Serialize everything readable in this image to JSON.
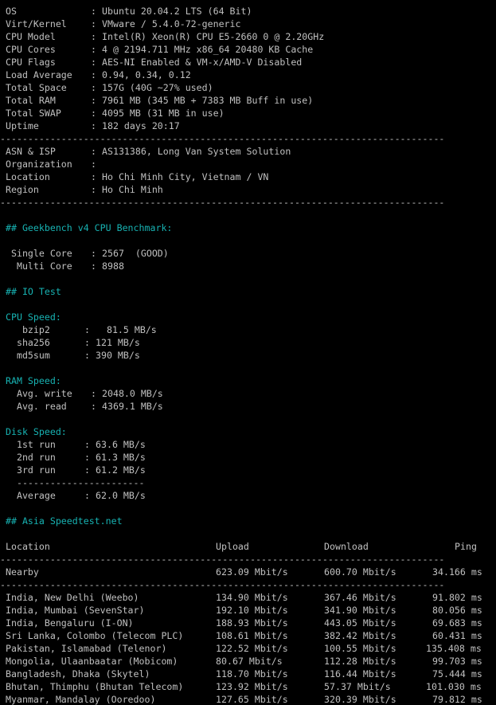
{
  "colors": {
    "background": "#000000",
    "text": "#c0c0c0",
    "accent": "#17b3b3"
  },
  "system": [
    {
      "label": "OS",
      "value": "Ubuntu 20.04.2 LTS (64 Bit)"
    },
    {
      "label": "Virt/Kernel",
      "value": "VMware / 5.4.0-72-generic"
    },
    {
      "label": "CPU Model",
      "value": "Intel(R) Xeon(R) CPU E5-2660 0 @ 2.20GHz"
    },
    {
      "label": "CPU Cores",
      "value": "4 @ 2194.711 MHz x86_64 20480 KB Cache"
    },
    {
      "label": "CPU Flags",
      "value": "AES-NI Enabled & VM-x/AMD-V Disabled"
    },
    {
      "label": "Load Average",
      "value": "0.94, 0.34, 0.12"
    },
    {
      "label": "Total Space",
      "value": "157G (40G ~27% used)"
    },
    {
      "label": "Total RAM",
      "value": "7961 MB (345 MB + 7383 MB Buff in use)"
    },
    {
      "label": "Total SWAP",
      "value": "4095 MB (31 MB in use)"
    },
    {
      "label": "Uptime",
      "value": "182 days 20:17"
    }
  ],
  "separator": "--------------------------------------------------------------------------------",
  "network": [
    {
      "label": "ASN & ISP",
      "value": "AS131386, Long Van System Solution"
    },
    {
      "label": "Organization",
      "value": ""
    },
    {
      "label": "Location",
      "value": "Ho Chi Minh City, Vietnam / VN"
    },
    {
      "label": "Region",
      "value": "Ho Chi Minh"
    }
  ],
  "geekbench": {
    "heading": "## Geekbench v4 CPU Benchmark:",
    "single_label": " Single Core",
    "single_value": "2567  (GOOD)",
    "multi_label": "  Multi Core",
    "multi_value": "8988"
  },
  "io": {
    "heading": "## IO Test",
    "cpu_heading": "CPU Speed:",
    "cpu": [
      {
        "label": "   bzip2",
        "value": "  81.5 MB/s"
      },
      {
        "label": "  sha256",
        "value": "121 MB/s"
      },
      {
        "label": "  md5sum",
        "value": "390 MB/s"
      }
    ],
    "ram_heading": "RAM Speed:",
    "ram": [
      {
        "label": "  Avg. write",
        "value": "2048.0 MB/s"
      },
      {
        "label": "  Avg. read",
        "value": "4369.1 MB/s"
      }
    ],
    "disk_heading": "Disk Speed:",
    "disk": [
      {
        "label": "  1st run",
        "value": "63.6 MB/s"
      },
      {
        "label": "  2nd run",
        "value": "61.3 MB/s"
      },
      {
        "label": "  3rd run",
        "value": "61.2 MB/s"
      }
    ],
    "disk_rule": "  -----------------------",
    "average_label": "  Average",
    "average_value": "62.0 MB/s"
  },
  "speedtest": {
    "heading": "## Asia Speedtest.net",
    "headers": {
      "location": "Location",
      "upload": "Upload",
      "download": "Download",
      "ping": "Ping"
    },
    "nearby": {
      "location": "Nearby",
      "upload": "623.09 Mbit/s",
      "download": "600.70 Mbit/s",
      "ping": "34.166 ms"
    },
    "rows": [
      {
        "location": "India, New Delhi (Weebo)",
        "upload": "134.90 Mbit/s",
        "download": "367.46 Mbit/s",
        "ping": "91.802 ms"
      },
      {
        "location": "India, Mumbai (SevenStar)",
        "upload": "192.10 Mbit/s",
        "download": "341.90 Mbit/s",
        "ping": "80.056 ms"
      },
      {
        "location": "India, Bengaluru (I-ON)",
        "upload": "188.93 Mbit/s",
        "download": "443.05 Mbit/s",
        "ping": "69.683 ms"
      },
      {
        "location": "Sri Lanka, Colombo (Telecom PLC)",
        "upload": "108.61 Mbit/s",
        "download": "382.42 Mbit/s",
        "ping": "60.431 ms"
      },
      {
        "location": "Pakistan, Islamabad (Telenor)",
        "upload": "122.52 Mbit/s",
        "download": "100.55 Mbit/s",
        "ping": "135.408 ms"
      },
      {
        "location": "Mongolia, Ulaanbaatar (Mobicom)",
        "upload": "80.67 Mbit/s",
        "download": "112.28 Mbit/s",
        "ping": "99.703 ms"
      },
      {
        "location": "Bangladesh, Dhaka (Skytel)",
        "upload": "118.70 Mbit/s",
        "download": "116.44 Mbit/s",
        "ping": "75.444 ms"
      },
      {
        "location": "Bhutan, Thimphu (Bhutan Telecom)",
        "upload": "123.92 Mbit/s",
        "download": "57.37 Mbit/s",
        "ping": "101.030 ms"
      },
      {
        "location": "Myanmar, Mandalay (Ooredoo)",
        "upload": "127.65 Mbit/s",
        "download": "320.39 Mbit/s",
        "ping": "79.812 ms"
      }
    ]
  }
}
